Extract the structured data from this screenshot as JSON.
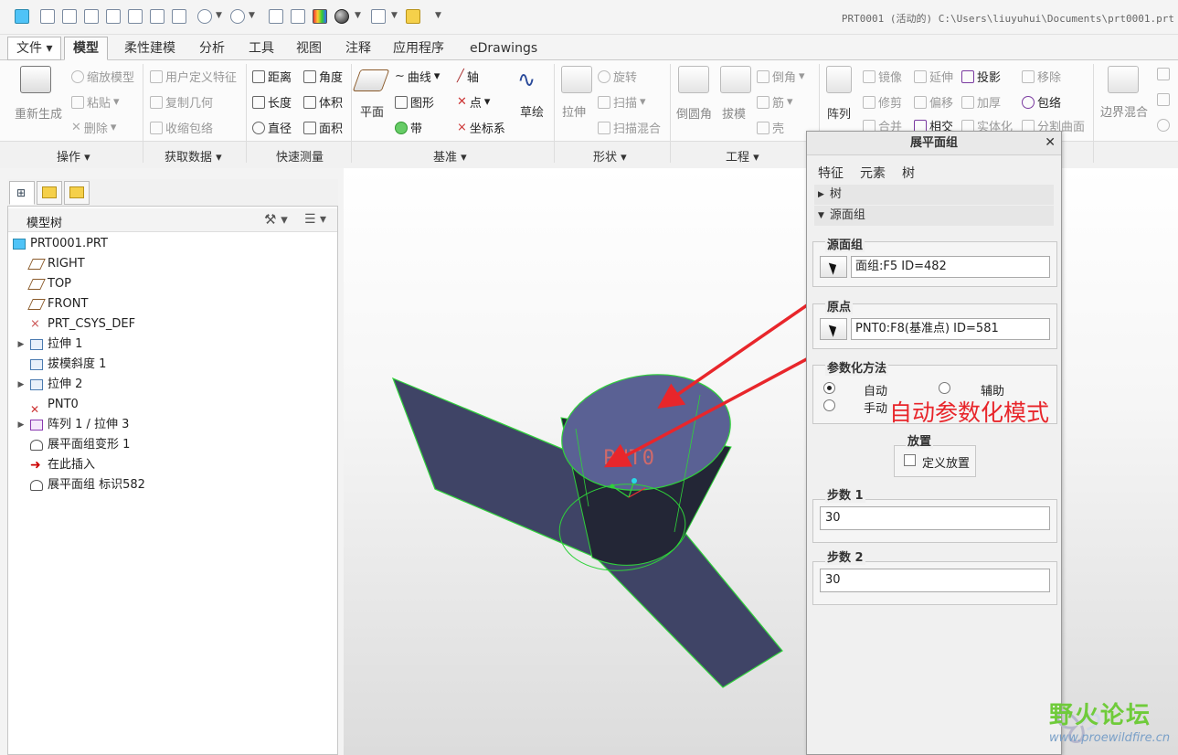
{
  "title_path": "PRT0001 (活动的) C:\\Users\\liuyuhui\\Documents\\prt0001.prt",
  "tabs": [
    "文件",
    "模型",
    "柔性建模",
    "分析",
    "工具",
    "视图",
    "注释",
    "应用程序",
    "eDrawings"
  ],
  "ribbon": {
    "operations": {
      "regenerate": "重新生成",
      "scale_model": "缩放模型",
      "paste": "粘贴",
      "delete": "删除",
      "label": "操作"
    },
    "get_data": {
      "udf": "用户定义特征",
      "copy_geom": "复制几何",
      "shrinkwrap": "收缩包络",
      "label": "获取数据"
    },
    "measure": {
      "distance": "距离",
      "angle": "角度",
      "length": "长度",
      "volume": "体积",
      "diameter": "直径",
      "area": "面积",
      "label": "快速测量"
    },
    "datum": {
      "plane": "平面",
      "curve": "曲线",
      "axis": "轴",
      "graph": "图形",
      "point": "点",
      "ribbon": "带",
      "csys": "坐标系",
      "sketch": "草绘",
      "label": "基准"
    },
    "shape": {
      "extrude": "拉伸",
      "revolve": "旋转",
      "sweep": "扫描",
      "swept_blend": "扫描混合",
      "label": "形状"
    },
    "engineering": {
      "round": "倒圆角",
      "draft": "拔模",
      "chamfer": "倒角",
      "rib": "筋",
      "shell": "壳",
      "label": "工程"
    },
    "editing": {
      "pattern": "阵列",
      "mirror": "镜像",
      "extend": "延伸",
      "project": "投影",
      "remove": "移除",
      "trim": "修剪",
      "offset": "偏移",
      "thicken": "加厚",
      "wrap": "包络",
      "merge": "合并",
      "intersect": "相交",
      "solidify": "实体化",
      "split_surface": "分割曲面"
    },
    "surfaces": {
      "boundary_blend": "边界混合"
    }
  },
  "model_tree": {
    "title": "模型树",
    "items": [
      {
        "label": "PRT0001.PRT",
        "icon": "part-icon",
        "expand": false
      },
      {
        "label": "RIGHT",
        "icon": "datum-plane-icon",
        "expand": false
      },
      {
        "label": "TOP",
        "icon": "datum-plane-icon",
        "expand": false
      },
      {
        "label": "FRONT",
        "icon": "datum-plane-icon",
        "expand": false
      },
      {
        "label": "PRT_CSYS_DEF",
        "icon": "csys-icon",
        "expand": false
      },
      {
        "label": "拉伸 1",
        "icon": "extrude-icon",
        "expand": true
      },
      {
        "label": "拔模斜度 1",
        "icon": "draft-icon",
        "expand": false
      },
      {
        "label": "拉伸 2",
        "icon": "extrude-icon",
        "expand": true
      },
      {
        "label": "PNT0",
        "icon": "datum-point-icon",
        "expand": false
      },
      {
        "label": "阵列 1 / 拉伸 3",
        "icon": "pattern-icon",
        "expand": true
      },
      {
        "label": "展平面组变形 1",
        "icon": "flatten-deform-icon",
        "expand": false
      },
      {
        "label": "在此插入",
        "icon": "insert-here-icon",
        "expand": false
      },
      {
        "label": "展平面组 标识582",
        "icon": "flatten-quilt-icon",
        "expand": false
      }
    ]
  },
  "dialog": {
    "title": "展平面组",
    "tabs": [
      "特征",
      "元素",
      "树"
    ],
    "sections": {
      "tree": "树",
      "source": "源面组"
    },
    "source_quilt": {
      "legend": "源面组",
      "value": "面组:F5 ID=482"
    },
    "origin": {
      "legend": "原点",
      "value": "PNT0:F8(基准点) ID=581"
    },
    "param_method": {
      "legend": "参数化方法",
      "auto": "自动",
      "assist": "辅助",
      "manual": "手动",
      "selected": "auto"
    },
    "placement": {
      "legend": "放置",
      "define": "定义放置"
    },
    "steps1": {
      "legend": "步数 1",
      "value": "30"
    },
    "steps2": {
      "legend": "步数 2",
      "value": "30"
    }
  },
  "annotation": "自动参数化模式",
  "point_label": "PNT0",
  "watermark": {
    "name": "野火论坛",
    "url": "www.proewildfire.cn"
  },
  "colors": {
    "surface": "#3f4466",
    "edges": "#2fd23a",
    "annotation": "#e8262b"
  }
}
